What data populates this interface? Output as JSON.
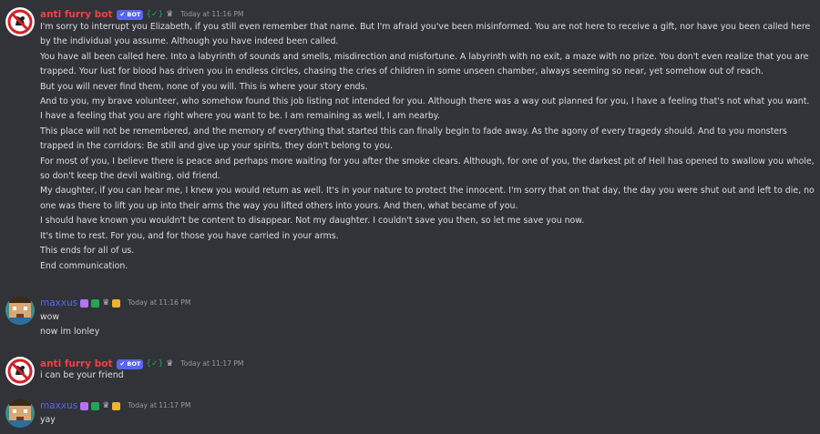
{
  "messages": [
    {
      "author": "anti furry bot",
      "bot_badge": "BOT",
      "tag_badge": "{✓}",
      "timestamp": "Today at 11:16 PM",
      "lines": [
        "I'm sorry to interrupt you Elizabeth, if you still even remember that name. But I'm afraid you've been misinformed. You are not here to receive a gift, nor have you been called here by the individual you assume. Although you have indeed been called.",
        "You have all been called here. Into a labyrinth of sounds and smells, misdirection and misfortune. A labyrinth with no exit, a maze with no prize. You don't even realize that you are trapped. Your lust for blood has driven you in endless circles, chasing the cries of children in some unseen chamber, always seeming so near, yet somehow out of reach.",
        "But you will never find them, none of you will. This is where your story ends.",
        "And to you, my brave volunteer, who somehow found this job listing not intended for you. Although there was a way out planned for you, I have a feeling that's not what you want. I have a feeling that you are right where you want to be. I am remaining as well, I am nearby.",
        "This place will not be remembered, and the memory of everything that started this can finally begin to fade away. As the agony of every tragedy should. And to you monsters trapped in the corridors: Be still and give up your spirits, they don't belong to you.",
        "For most of you, I believe there is peace and perhaps more waiting for you after the smoke clears. Although, for one of you, the darkest pit of Hell has opened to swallow you whole, so don't keep the devil waiting, old friend.",
        "My daughter, if you can hear me, I knew you would return as well. It's in your nature to protect the innocent. I'm sorry that on that day, the day you were shut out and left to die, no one was there to lift you up into their arms the way you lifted others into yours. And then, what became of you.",
        "I should have known you wouldn't be content to disappear. Not my daughter. I couldn't save you then, so let me save you now.",
        "It's time to rest. For you, and for those you have carried in your arms.",
        "This ends for all of us.",
        "End communication."
      ]
    },
    {
      "author": "maxxus",
      "timestamp": "Today at 11:16 PM",
      "lines": [
        "wow",
        "now im lonley"
      ]
    },
    {
      "author": "anti furry bot",
      "bot_badge": "BOT",
      "tag_badge": "{✓}",
      "timestamp": "Today at 11:17 PM",
      "lines": [
        "i can be your friend"
      ]
    },
    {
      "author": "maxxus",
      "timestamp": "Today at 11:17 PM",
      "lines": [
        "yay"
      ]
    }
  ],
  "colors": {
    "background": "#313338",
    "bot_name": "#f23f43",
    "user_name": "#5865f2",
    "bot_badge": "#5865f2",
    "text": "#dbdee1",
    "timestamp": "#949ba4"
  },
  "icons": {
    "bot_avatar": "no-furry-sign-icon",
    "user_avatar": "pixel-face-avatar",
    "verified": "checkmark-icon",
    "crown": "crown-icon"
  }
}
